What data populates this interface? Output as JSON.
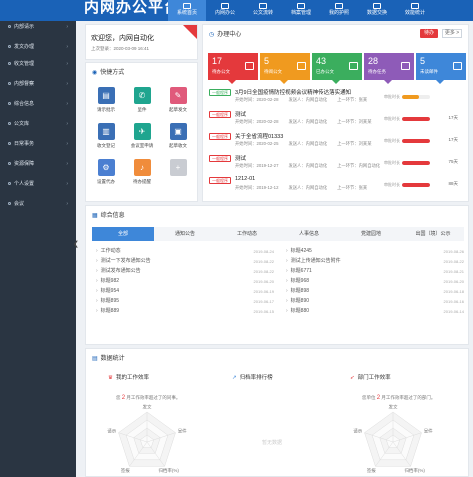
{
  "app": {
    "title": "内网办公平台"
  },
  "topnav": [
    {
      "label": "系统首页",
      "active": true
    },
    {
      "label": "内网办公",
      "active": false
    },
    {
      "label": "公文流转",
      "active": false
    },
    {
      "label": "档案管理",
      "active": false
    },
    {
      "label": "我的护照",
      "active": false
    },
    {
      "label": "数据交换",
      "active": false
    },
    {
      "label": "效能统计",
      "active": false
    }
  ],
  "sidebar": {
    "items": [
      {
        "label": "内部请示"
      },
      {
        "label": "发文办理"
      },
      {
        "label": "收文管理"
      },
      {
        "label": "内部督察"
      },
      {
        "label": "综合信息"
      },
      {
        "label": "公文库"
      },
      {
        "label": "日常事务"
      },
      {
        "label": "资源保障"
      },
      {
        "label": "个人设置"
      },
      {
        "label": "会议"
      }
    ]
  },
  "welcome": {
    "title": "欢迎您，内网自动化",
    "last_login": "上次登录：2020-03-09 16:41"
  },
  "shortcuts": {
    "title": "快捷方式",
    "items": [
      {
        "label": "请示批示",
        "color": "#3a6fb5",
        "icon": "document-icon"
      },
      {
        "label": "呈件",
        "color": "#1fa58f",
        "icon": "phone-icon"
      },
      {
        "label": "起草发文",
        "color": "#e05a7b",
        "icon": "edit-icon"
      },
      {
        "label": "收文登记",
        "color": "#3a6fb5",
        "icon": "inbox-icon"
      },
      {
        "label": "会议室申请",
        "color": "#1fa58f",
        "icon": "plane-icon"
      },
      {
        "label": "起草收文",
        "color": "#3a6fb5",
        "icon": "folder-icon"
      },
      {
        "label": "设置代办",
        "color": "#4b7fd1",
        "icon": "settings-icon"
      },
      {
        "label": "待办提醒",
        "color": "#f08c3b",
        "icon": "bell-icon"
      },
      {
        "label": "",
        "color": "#c9ccd2",
        "icon": "add-icon"
      }
    ]
  },
  "todo": {
    "title": "办理中心",
    "btn_todo": "待办",
    "btn_more": "更多 >",
    "tiles": [
      {
        "num": "17",
        "label": "待办公文",
        "color": "#e4393c"
      },
      {
        "num": "5",
        "label": "待阅公文",
        "color": "#f09a1f"
      },
      {
        "num": "43",
        "label": "已办公文",
        "color": "#3bae5e"
      },
      {
        "num": "28",
        "label": "待办任务",
        "color": "#8e5bb8"
      },
      {
        "num": "5",
        "label": "未读邮件",
        "color": "#3e87d9"
      }
    ],
    "rows": [
      {
        "tag": "一般程序",
        "tag_type": "green",
        "title": "3月9日全国疫情防控视频会议精神传达落实通知",
        "start": "2020-02-28",
        "sender": "内网自动化",
        "step": "张某",
        "progress": 0.6,
        "pct": "",
        "color": "orange"
      },
      {
        "tag": "一般程序",
        "tag_type": "red",
        "title": "测试",
        "start": "2020-02-28",
        "sender": "内网自动化",
        "step": "刘某某",
        "progress": 1.0,
        "pct": "17天",
        "color": "red"
      },
      {
        "tag": "一般程序",
        "tag_type": "red",
        "title": "关于全省流程01333",
        "start": "2020-02-25",
        "sender": "内网自动化",
        "step": "刘某某",
        "progress": 1.0,
        "pct": "17天",
        "color": "red"
      },
      {
        "tag": "一般程序",
        "tag_type": "red",
        "title": "测试",
        "start": "2019-12-27",
        "sender": "内网自动化",
        "step": "内网自动化",
        "progress": 1.0,
        "pct": "75天",
        "color": "red"
      },
      {
        "tag": "一般程序",
        "tag_type": "red",
        "title": "1212-01",
        "start": "2019-12-12",
        "sender": "内网自动化",
        "step": "张某",
        "progress": 1.0,
        "pct": "88天",
        "color": "red"
      }
    ],
    "meta_start": "开始时间：",
    "meta_sender": "发送人：",
    "meta_step": "上一环节：",
    "progress_label": "审批时长"
  },
  "info": {
    "title": "综合信息",
    "tabs": [
      "全部",
      "通知公告",
      "工作动态",
      "人事信息",
      "党建园地",
      "出国（境）公示"
    ],
    "left": [
      {
        "title": "工作动态",
        "date": "2019-08-24"
      },
      {
        "title": "测试一下发布通知公告",
        "date": "2019-08-22"
      },
      {
        "title": "测试发布通知公告",
        "date": "2019-08-22"
      },
      {
        "title": "标题982",
        "date": "2019-06-20"
      },
      {
        "title": "标题954",
        "date": "2019-06-19"
      },
      {
        "title": "标题895",
        "date": "2019-06-17"
      },
      {
        "title": "标题889",
        "date": "2019-06-15"
      }
    ],
    "right": [
      {
        "title": "标题4245",
        "date": "2019-08-26"
      },
      {
        "title": "测试上传通知公告附件",
        "date": "2019-08-22"
      },
      {
        "title": "标题6771",
        "date": "2019-08-21"
      },
      {
        "title": "标题968",
        "date": "2019-06-20"
      },
      {
        "title": "标题898",
        "date": "2019-06-18"
      },
      {
        "title": "标题890",
        "date": "2019-06-16"
      },
      {
        "title": "标题880",
        "date": "2019-06-14"
      }
    ]
  },
  "stats": {
    "title": "数据统计",
    "my_eff": {
      "title": "我的工作效率",
      "desc_pre": "您",
      "num": "2",
      "desc_post": "月工作效率超过了的同事。"
    },
    "rank": {
      "title": "归档率排行榜",
      "nodata": "暂无数据"
    },
    "dept": {
      "title": "部门工作效率",
      "desc_pre": "您单位",
      "num": "2",
      "desc_post": "月工作效率超过了的部门。"
    },
    "radar_labels": [
      "发文",
      "呈件",
      "归档率(%)",
      "签报",
      "请示"
    ]
  }
}
